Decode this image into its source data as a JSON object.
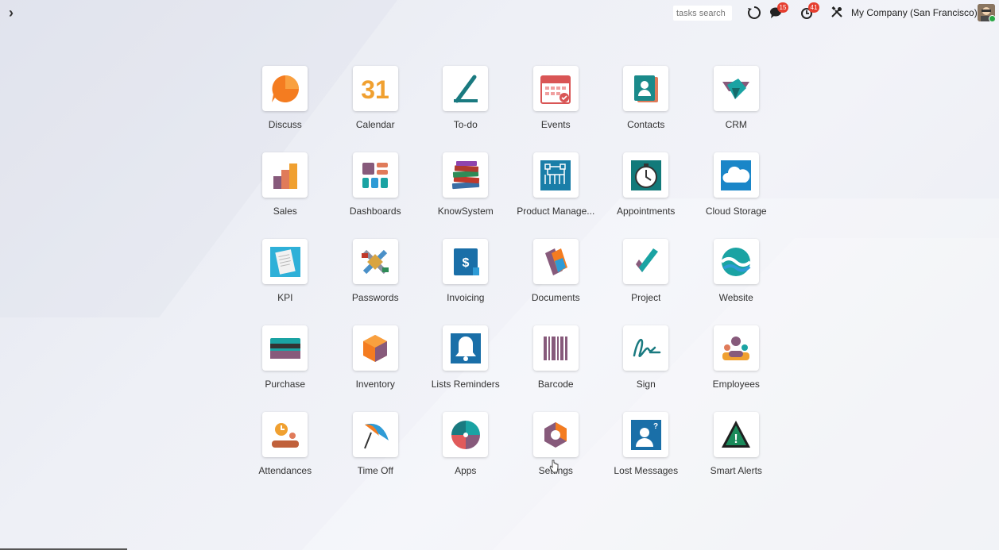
{
  "topbar": {
    "search_placeholder": "tasks search",
    "messages_count": "15",
    "activities_count": "41",
    "company": "My Company (San Francisco)"
  },
  "apps": [
    {
      "label": "Discuss",
      "icon": "discuss-icon"
    },
    {
      "label": "Calendar",
      "icon": "calendar-icon",
      "icon_text": "31"
    },
    {
      "label": "To-do",
      "icon": "todo-icon"
    },
    {
      "label": "Events",
      "icon": "events-icon"
    },
    {
      "label": "Contacts",
      "icon": "contacts-icon"
    },
    {
      "label": "CRM",
      "icon": "crm-icon"
    },
    {
      "label": "Sales",
      "icon": "sales-icon"
    },
    {
      "label": "Dashboards",
      "icon": "dashboards-icon"
    },
    {
      "label": "KnowSystem",
      "icon": "knowsystem-icon"
    },
    {
      "label": "Product Manage...",
      "icon": "product-management-icon"
    },
    {
      "label": "Appointments",
      "icon": "appointments-icon"
    },
    {
      "label": "Cloud Storage",
      "icon": "cloud-storage-icon"
    },
    {
      "label": "KPI",
      "icon": "kpi-icon"
    },
    {
      "label": "Passwords",
      "icon": "passwords-icon"
    },
    {
      "label": "Invoicing",
      "icon": "invoicing-icon",
      "icon_text": "$"
    },
    {
      "label": "Documents",
      "icon": "documents-icon"
    },
    {
      "label": "Project",
      "icon": "project-icon"
    },
    {
      "label": "Website",
      "icon": "website-icon"
    },
    {
      "label": "Purchase",
      "icon": "purchase-icon"
    },
    {
      "label": "Inventory",
      "icon": "inventory-icon"
    },
    {
      "label": "Lists Reminders",
      "icon": "lists-reminders-icon"
    },
    {
      "label": "Barcode",
      "icon": "barcode-icon"
    },
    {
      "label": "Sign",
      "icon": "sign-icon"
    },
    {
      "label": "Employees",
      "icon": "employees-icon"
    },
    {
      "label": "Attendances",
      "icon": "attendances-icon"
    },
    {
      "label": "Time Off",
      "icon": "time-off-icon"
    },
    {
      "label": "Apps",
      "icon": "apps-icon"
    },
    {
      "label": "Settings",
      "icon": "settings-icon"
    },
    {
      "label": "Lost Messages",
      "icon": "lost-messages-icon",
      "icon_text": "?"
    },
    {
      "label": "Smart Alerts",
      "icon": "smart-alerts-icon",
      "icon_text": "!"
    }
  ],
  "colors": {
    "orange": "#f47c20",
    "teal": "#1aa3a3",
    "purple": "#875a7b",
    "blue": "#2e9bd6",
    "badge_red": "#e53e2f"
  }
}
